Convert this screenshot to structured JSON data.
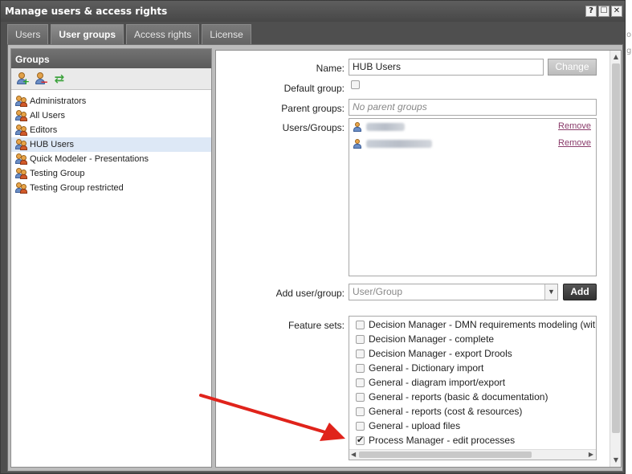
{
  "window": {
    "title": "Manage users & access rights",
    "controls": [
      "?",
      "☐",
      "✕"
    ]
  },
  "tabs": [
    {
      "label": "Users",
      "active": false
    },
    {
      "label": "User groups",
      "active": true
    },
    {
      "label": "Access rights",
      "active": false
    },
    {
      "label": "License",
      "active": false
    }
  ],
  "groups_panel": {
    "title": "Groups",
    "toolbar": [
      "add-group-icon",
      "remove-group-icon",
      "refresh-icon"
    ],
    "items": [
      {
        "label": "Administrators",
        "selected": false
      },
      {
        "label": "All Users",
        "selected": false
      },
      {
        "label": "Editors",
        "selected": false
      },
      {
        "label": "HUB Users",
        "selected": true
      },
      {
        "label": "Quick Modeler - Presentations",
        "selected": false
      },
      {
        "label": "Testing Group",
        "selected": false
      },
      {
        "label": "Testing Group restricted",
        "selected": false
      }
    ]
  },
  "form": {
    "name_label": "Name:",
    "name_value": "HUB Users",
    "change_button": "Change",
    "default_group_label": "Default group:",
    "default_group_checked": false,
    "parent_groups_label": "Parent groups:",
    "parent_groups_placeholder": "No parent groups",
    "users_groups_label": "Users/Groups:",
    "members": [
      {
        "name": "",
        "remove_label": "Remove"
      },
      {
        "name": "",
        "remove_label": "Remove"
      }
    ],
    "add_user_group_label": "Add user/group:",
    "add_user_group_placeholder": "User/Group",
    "add_button": "Add",
    "feature_sets_label": "Feature sets:",
    "feature_sets": [
      {
        "label": "Decision Manager - DMN requirements modeling (witho",
        "checked": false
      },
      {
        "label": "Decision Manager - complete",
        "checked": false
      },
      {
        "label": "Decision Manager - export Drools",
        "checked": false
      },
      {
        "label": "General - Dictionary import",
        "checked": false
      },
      {
        "label": "General - diagram import/export",
        "checked": false
      },
      {
        "label": "General - reports (basic & documentation)",
        "checked": false
      },
      {
        "label": "General - reports (cost & resources)",
        "checked": false
      },
      {
        "label": "General - upload files",
        "checked": false
      },
      {
        "label": "Process Manager - edit processes",
        "checked": true
      }
    ]
  },
  "colors": {
    "window_bg": "#4f4f4f",
    "selected_row": "#dde8f6",
    "link": "#8a3c6b",
    "annotation_arrow": "#e0231b"
  }
}
